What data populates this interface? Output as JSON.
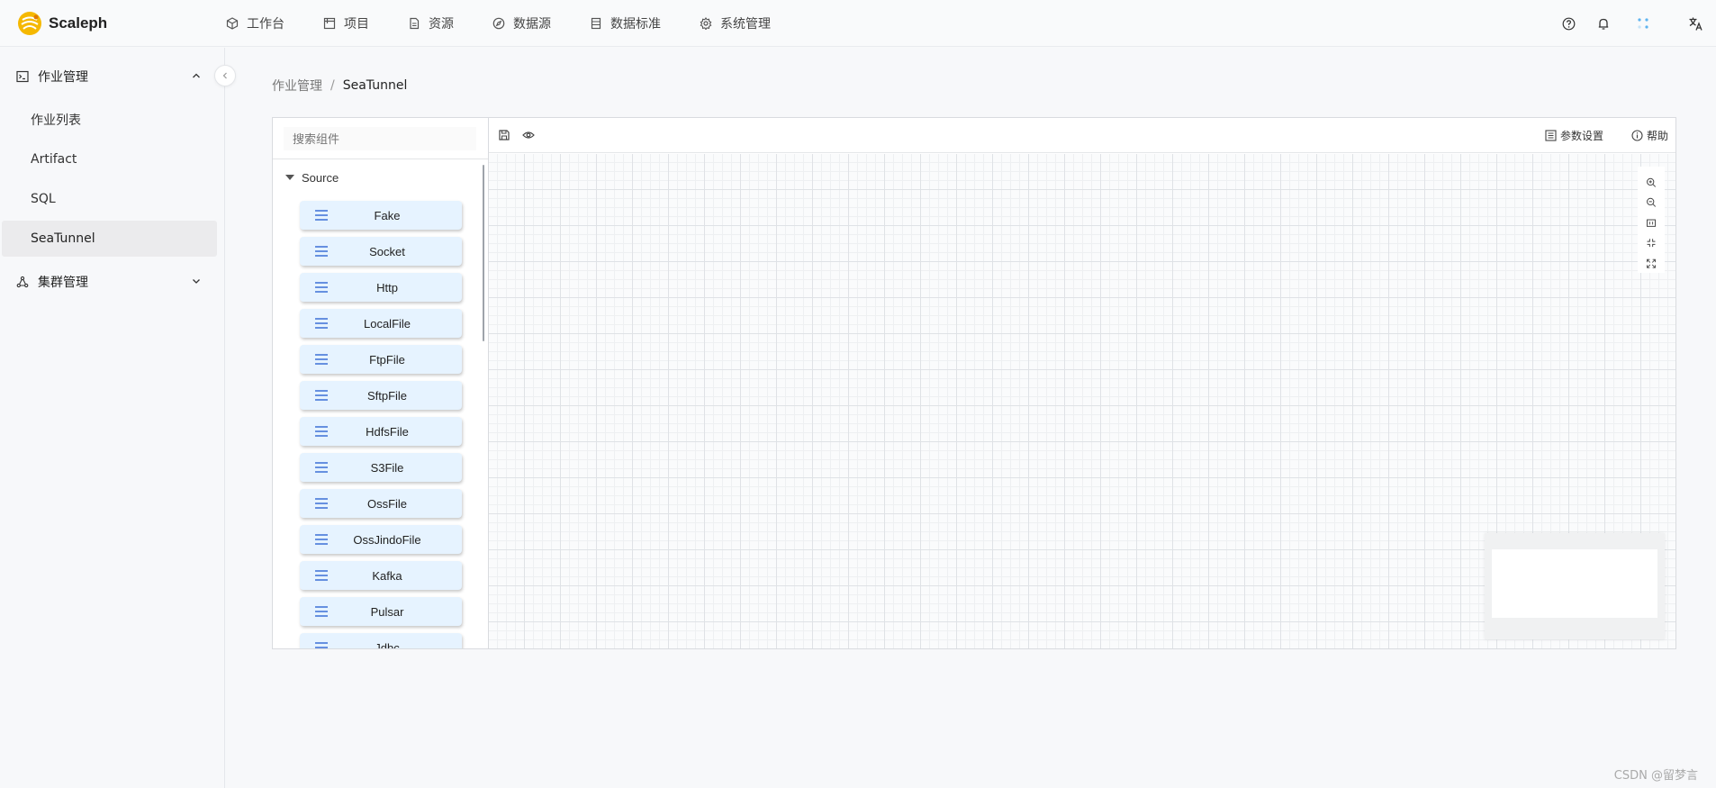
{
  "app": {
    "name": "Scaleph"
  },
  "nav": [
    {
      "label": "工作台",
      "icon": "cube-icon"
    },
    {
      "label": "项目",
      "icon": "project-icon"
    },
    {
      "label": "资源",
      "icon": "resource-icon"
    },
    {
      "label": "数据源",
      "icon": "compass-icon"
    },
    {
      "label": "数据标准",
      "icon": "table-icon"
    },
    {
      "label": "系统管理",
      "icon": "gear-icon"
    }
  ],
  "sidebar": {
    "groups": [
      {
        "label": "作业管理",
        "icon": "terminal-icon",
        "expanded": true,
        "items": [
          "作业列表",
          "Artifact",
          "SQL",
          "SeaTunnel"
        ],
        "active": "SeaTunnel"
      },
      {
        "label": "集群管理",
        "icon": "cluster-icon",
        "expanded": false
      }
    ]
  },
  "breadcrumb": {
    "parent": "作业管理",
    "separator": "/",
    "current": "SeaTunnel"
  },
  "stencil": {
    "search_placeholder": "搜索组件",
    "group_title": "Source",
    "components": [
      "Fake",
      "Socket",
      "Http",
      "LocalFile",
      "FtpFile",
      "SftpFile",
      "HdfsFile",
      "S3File",
      "OssFile",
      "OssJindoFile",
      "Kafka",
      "Pulsar",
      "Jdbc"
    ]
  },
  "toolbar": {
    "params_label": "参数设置",
    "help_label": "帮助"
  },
  "watermark": "CSDN @留梦言",
  "colors": {
    "component_bg": "#e6f3ff",
    "component_icon": "#3b6fd6",
    "brand_yellow": "#f5b800"
  }
}
